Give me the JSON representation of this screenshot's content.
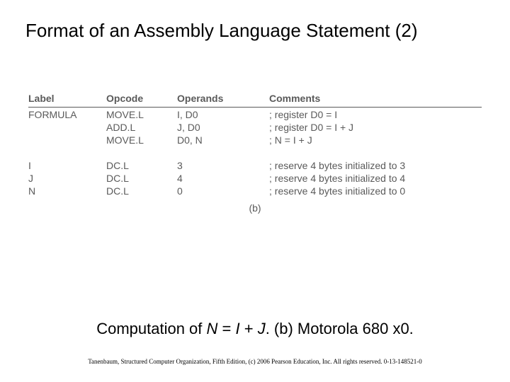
{
  "title": "Format of an Assembly Language Statement (2)",
  "headers": {
    "label": "Label",
    "opcode": "Opcode",
    "operands": "Operands",
    "comments": "Comments"
  },
  "block1": [
    {
      "label": "FORMULA",
      "opcode": "MOVE.L",
      "operands": "I, D0",
      "comments": "; register D0 = I"
    },
    {
      "label": "",
      "opcode": "ADD.L",
      "operands": "J, D0",
      "comments": "; register D0 = I + J"
    },
    {
      "label": "",
      "opcode": "MOVE.L",
      "operands": "D0, N",
      "comments": "; N = I + J"
    }
  ],
  "block2": [
    {
      "label": "I",
      "opcode": "DC.L",
      "operands": "3",
      "comments": "; reserve 4 bytes initialized to 3"
    },
    {
      "label": "J",
      "opcode": "DC.L",
      "operands": "4",
      "comments": "; reserve 4 bytes initialized to 4"
    },
    {
      "label": "N",
      "opcode": "DC.L",
      "operands": "0",
      "comments": "; reserve 4 bytes initialized to 0"
    }
  ],
  "captionB": "(b)",
  "subtitle": {
    "pre": "Computation of ",
    "eqN": "N",
    "mid1": " = ",
    "eqI": "I",
    "mid2": " + ",
    "eqJ": "J",
    "post1": ".    ",
    "post2": "(b) Motorola 680 x0."
  },
  "footer": "Tanenbaum, Structured Computer Organization, Fifth Edition, (c) 2006 Pearson Education, Inc. All rights reserved. 0-13-148521-0"
}
